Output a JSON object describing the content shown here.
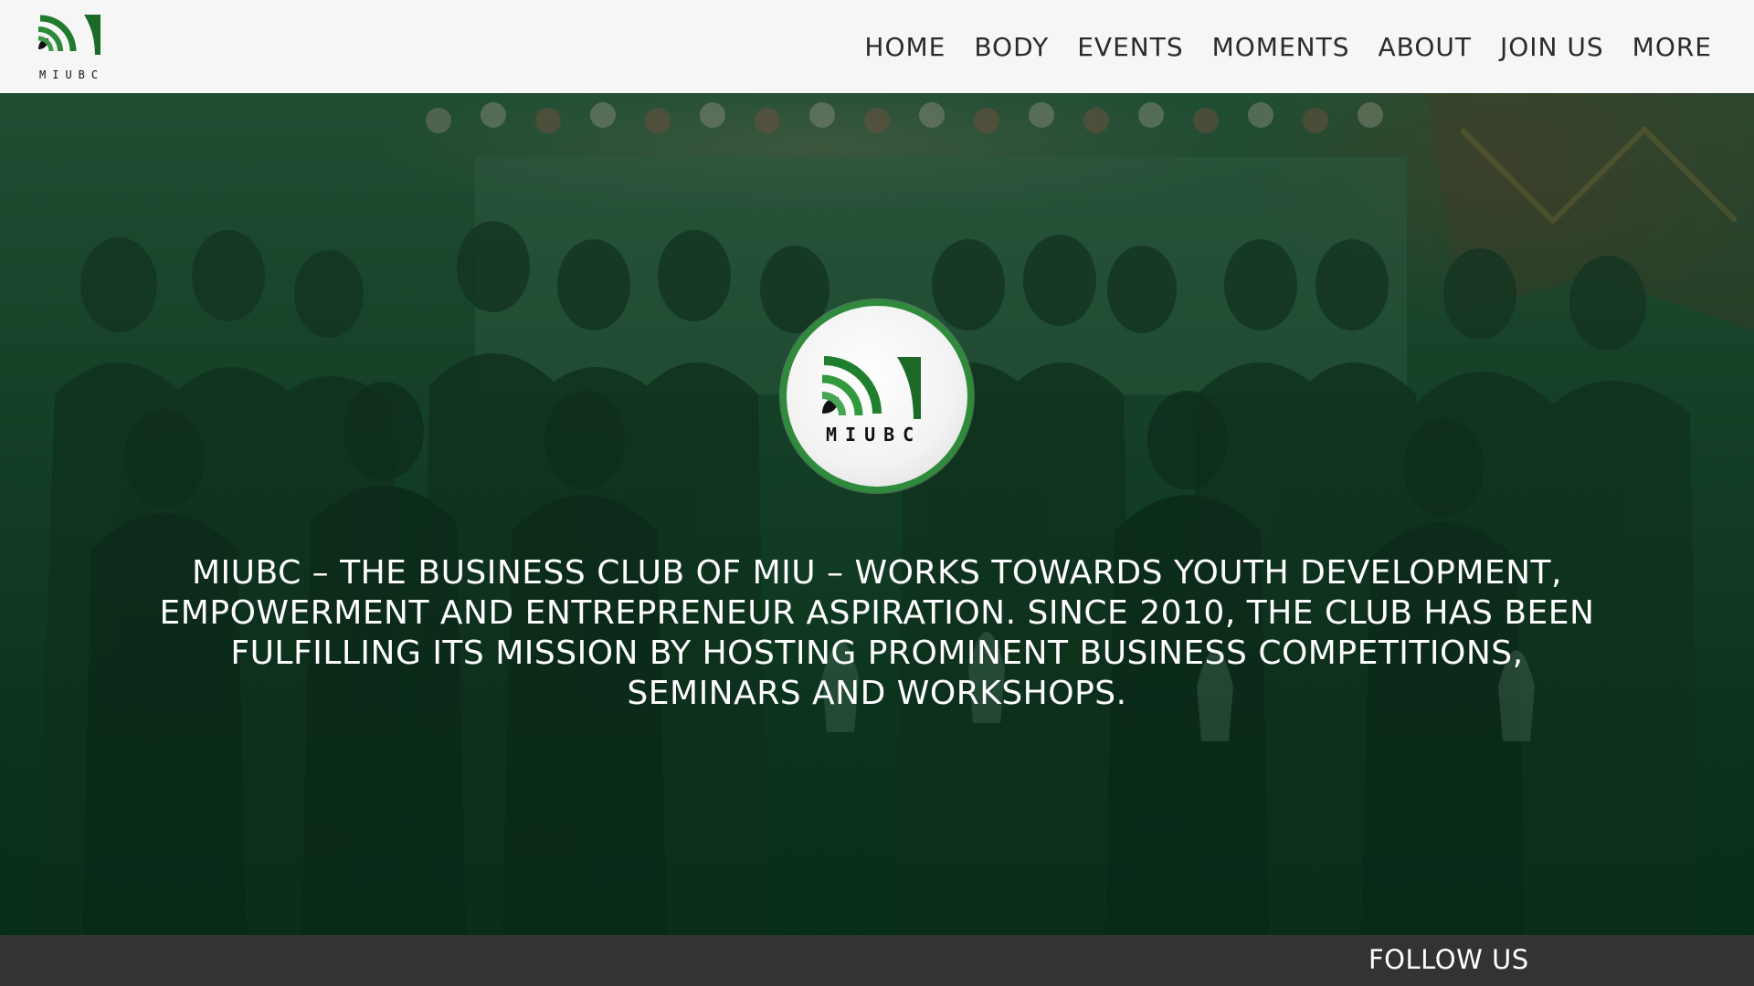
{
  "brand": {
    "logo_text": "MIUBC",
    "primary_green": "#2f8a3c",
    "dark_green": "#1b5e28",
    "icon": "miubc-logo-icon"
  },
  "nav": {
    "items": [
      {
        "label": "HOME"
      },
      {
        "label": "BODY"
      },
      {
        "label": "EVENTS"
      },
      {
        "label": "MOMENTS"
      },
      {
        "label": "ABOUT"
      },
      {
        "label": "JOIN US"
      },
      {
        "label": "MORE"
      }
    ]
  },
  "hero": {
    "mission_text": "MIUBC – THE BUSINESS CLUB OF MIU – WORKS TOWARDS YOUTH DEVELOPMENT, EMPOWERMENT AND ENTREPRENEUR ASPIRATION. SINCE 2010, THE CLUB HAS BEEN FULFILLING ITS MISSION BY HOSTING PROMINENT BUSINESS COMPETITIONS, SEMINARS AND WORKSHOPS."
  },
  "footer": {
    "follow_label": "FOLLOW US"
  }
}
